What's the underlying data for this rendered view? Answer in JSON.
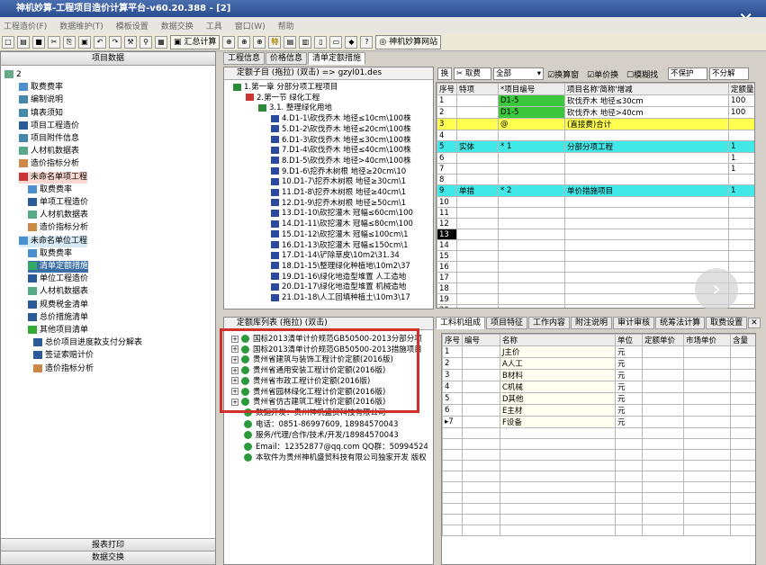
{
  "title": "神机妙算-工程项目造价计算平台-v60.20.388 - [2]",
  "menu": [
    "工程造价(F)",
    "数据维护(T)",
    "模板设置",
    "数据交换",
    "工具",
    "窗口(W)",
    "帮助"
  ],
  "toolbar": {
    "summary": "汇总计算",
    "special": "特",
    "website": "神机妙算网站"
  },
  "left": {
    "header": "项目数据",
    "items": [
      "2",
      "取费费率",
      "编制说明",
      "填表须知",
      "项目工程造价",
      "项目附件信息",
      "人材机数据表",
      "造价指标分析",
      "未命名单项工程",
      "取费费率",
      "单项工程造价",
      "人材机数据表",
      "造价指标分析",
      "未命名单位工程",
      "取费费率",
      "清单定额措施",
      "单位工程造价",
      "人材机数据表",
      "规费税金清单",
      "总价措施清单",
      "其他项目清单",
      "总价项目进度款支付分解表",
      "签证索赔计价",
      "造价指标分析"
    ],
    "footer1": "报表打印",
    "footer2": "数据交换"
  },
  "midtabs": [
    "工程信息",
    "价格信息",
    "清单定额措施"
  ],
  "quota": {
    "label": "定额子目 (拖拉) (双击) => gzyl01.des",
    "items": [
      "1.第一章 分部分项工程项目",
      "2.第一节 绿化工程",
      "3.1. 整理绿化用地",
      "4.D1-1\\砍伐乔木 地径≤10cm\\100株",
      "5.D1-2\\砍伐乔木 地径≤20cm\\100株",
      "6.D1-3\\砍伐乔木 地径≤30cm\\100株",
      "7.D1-4\\砍伐乔木 地径≤40cm\\100株",
      "8.D1-5\\砍伐乔木 地径>40cm\\100株",
      "9.D1-6\\挖乔木树根 地径≥20cm\\10",
      "10.D1-7\\挖乔木树根 地径≥30cm\\1",
      "11.D1-8\\挖乔木树根 地径≥40cm\\1",
      "12.D1-9\\挖乔木树根 地径≥50cm\\1",
      "13.D1-10\\砍挖灌木 冠幅≤60cm\\100",
      "14.D1-11\\砍挖灌木 冠幅≤80cm\\100",
      "15.D1-12\\砍挖灌木 冠幅≤100cm\\1",
      "16.D1-13\\砍挖灌木 冠幅≤150cm\\1",
      "17.D1-14\\铲除草皮\\10m2\\31.34",
      "18.D1-15\\整理绿化种植地\\10m2\\37",
      "19.D1-16\\绿化地造型堆置 人工造地",
      "20.D1-17\\绿化地造型堆置 机械造地",
      "21.D1-18\\人工回填种植土\\10m3\\17"
    ]
  },
  "library": {
    "label": "定额库列表 (拖拉) (双击)",
    "items": [
      "国标2013清单计价规范GB50500-2013分部分项",
      "国标2013清单计价规范GB50500-2013措施项目",
      "贵州省建筑与装饰工程计价定额(2016版)",
      "贵州省通用安装工程计价定额(2016版)",
      "贵州省市政工程计价定额(2016版)",
      "贵州省园林绿化工程计价定额(2016版)",
      "贵州省仿古建筑工程计价定额(2016版)"
    ],
    "info": [
      "数据开发：贵州神机盛贸科技有限公司",
      "电话：0851-86997609, 18984570043",
      "服务/代理/合作/技术/开发/18984570043",
      "Email：12352877@qq.com  QQ群：50994524",
      "本软件为贵州神机盛贸科技有限公司独家开发 版权"
    ]
  },
  "right": {
    "btn1": "换",
    "btn2": "取费",
    "select_all": "全部",
    "chk1": "换算窗",
    "chk2": "单价换",
    "chk3": "模糊找",
    "dd1": "不保护",
    "dd2": "不分解",
    "cols": [
      "序号",
      "特项",
      "*项目编号",
      "项目名称'简称'增减",
      "定额量"
    ],
    "rows": [
      [
        "1",
        "",
        "D1-5",
        "砍伐乔木 地径≤30cm",
        "100"
      ],
      [
        "2",
        "",
        "D1-5",
        "砍伐乔木 地径>40cm",
        "100"
      ],
      [
        "3",
        "",
        "@",
        "(直接费)合计",
        ""
      ],
      [
        "4",
        "",
        "",
        "",
        ""
      ],
      [
        "5",
        "实体",
        "* 1",
        "分部分项工程",
        "1"
      ],
      [
        "6",
        "",
        "",
        "",
        "1"
      ],
      [
        "7",
        "",
        "",
        "",
        "1"
      ],
      [
        "8",
        "",
        "",
        "",
        ""
      ],
      [
        "9",
        "单措",
        "* 2",
        "单价措施项目",
        "1"
      ],
      [
        "10",
        "",
        "",
        "",
        ""
      ],
      [
        "11",
        "",
        "",
        "",
        ""
      ],
      [
        "12",
        "",
        "",
        "",
        ""
      ],
      [
        "13",
        "",
        "",
        "",
        ""
      ],
      [
        "14",
        "",
        "",
        "",
        ""
      ],
      [
        "15",
        "",
        "",
        "",
        ""
      ],
      [
        "16",
        "",
        "",
        "",
        ""
      ],
      [
        "17",
        "",
        "",
        "",
        ""
      ],
      [
        "18",
        "",
        "",
        "",
        ""
      ],
      [
        "19",
        "",
        "",
        "",
        ""
      ],
      [
        "20",
        "",
        "",
        "",
        ""
      ],
      [
        "21",
        "",
        "",
        "",
        ""
      ]
    ]
  },
  "bottomtabs": [
    "工料机组成",
    "项目特征",
    "工作内容",
    "附注说明",
    "审计审核",
    "统筹法计算",
    "取费设置"
  ],
  "bottom": {
    "cols": [
      "序号",
      "编号",
      "名称",
      "单位",
      "定额单价",
      "市场单价",
      "含量",
      "损"
    ],
    "rows": [
      [
        "1",
        "",
        "J主价",
        "元"
      ],
      [
        "2",
        "",
        "A人工",
        "元"
      ],
      [
        "3",
        "",
        "B材料",
        "元"
      ],
      [
        "4",
        "",
        "C机械",
        "元"
      ],
      [
        "5",
        "",
        "D其他",
        "元"
      ],
      [
        "6",
        "",
        "E主材",
        "元"
      ],
      [
        "7",
        "",
        "F设备",
        "元"
      ]
    ]
  },
  "colors": {
    "green": "#3cc83c",
    "yellow": "#ffff50",
    "cyan": "#40e8e8",
    "select": "#3a6ea5",
    "red": "#d0302a"
  }
}
